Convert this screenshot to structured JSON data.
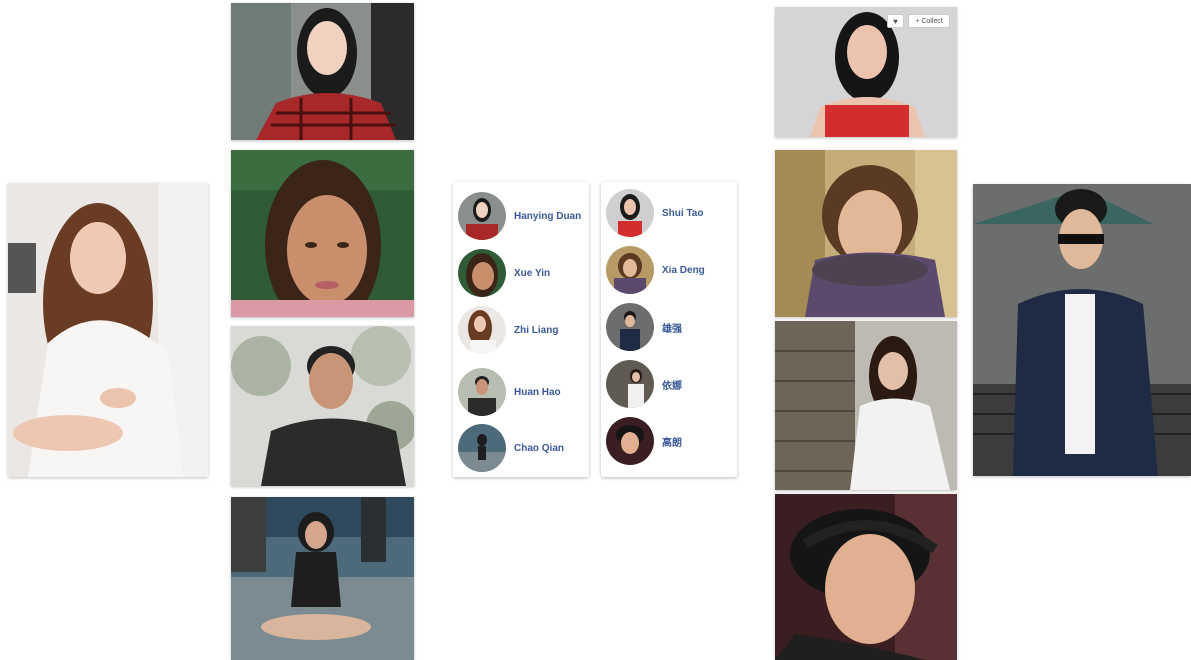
{
  "cards": {
    "left": [
      {
        "name": "Hanying Duan"
      },
      {
        "name": "Xue Yin"
      },
      {
        "name": "Zhi Liang"
      },
      {
        "name": "Huan Hao"
      },
      {
        "name": "Chao Qian"
      }
    ],
    "right": [
      {
        "name": "Shui Tao"
      },
      {
        "name": "Xia Deng"
      },
      {
        "name": "雄强"
      },
      {
        "name": "依娜"
      },
      {
        "name": "高朗"
      }
    ]
  },
  "overlay": {
    "like_icon": "heart-icon",
    "collect_icon": "plus-icon",
    "collect_label": "Collect"
  },
  "colors": {
    "name_link": "#3b5998"
  }
}
